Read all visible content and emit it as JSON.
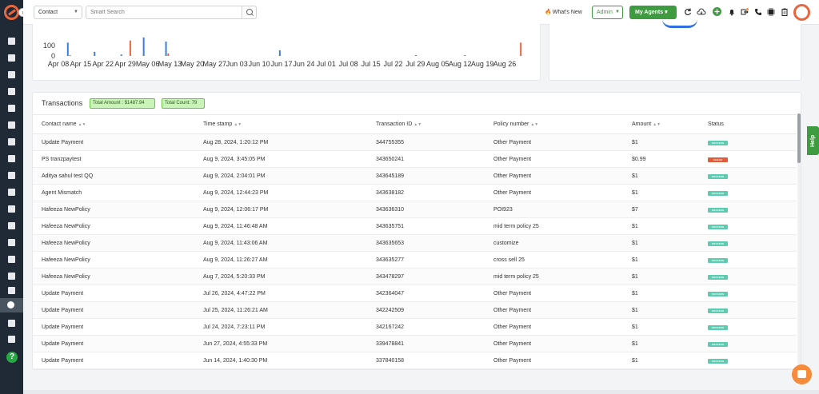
{
  "topbar": {
    "contact_select": "Contact",
    "search_placeholder": "Smart Search",
    "whats_new": "What's New",
    "admin_select": "Admin",
    "my_agents": "My Agents"
  },
  "sidebar": {
    "help_label": "?"
  },
  "chart_data": {
    "type": "bar",
    "y_ticks": [
      "100",
      "0"
    ],
    "x_labels": [
      "Apr 08",
      "Apr 15",
      "Apr 22",
      "Apr 29",
      "May 06",
      "May 13",
      "May 20",
      "May 27",
      "Jun 03",
      "Jun 10",
      "Jun 17",
      "Jun 24",
      "Jul 01",
      "Jul 08",
      "Jul 15",
      "Jul 22",
      "Jul 29",
      "Aug 05",
      "Aug 12",
      "Aug 19",
      "Aug 26"
    ],
    "series": [
      {
        "color": "#3b7ddd",
        "points": [
          [
            0.1,
            130
          ],
          [
            1.3,
            40
          ],
          [
            2.5,
            14
          ],
          [
            3.5,
            180
          ],
          [
            4.5,
            140
          ],
          [
            9.6,
            55
          ],
          [
            15.7,
            8
          ],
          [
            17.9,
            8
          ]
        ]
      },
      {
        "color": "#e8663d",
        "points": [
          [
            0.2,
            8
          ],
          [
            2.9,
            150
          ],
          [
            4.6,
            25
          ],
          [
            20.4,
            130
          ]
        ]
      }
    ],
    "ylim": [
      0,
      210
    ]
  },
  "transactions": {
    "title": "Transactions",
    "total_amount": "Total Amount : $1487.94",
    "total_count": "Total Count: 79",
    "columns": [
      "Contact name",
      "Time stamp",
      "Transaction ID",
      "Policy number",
      "Amount",
      "Status"
    ],
    "rows": [
      {
        "contact": "Update Payment",
        "time": "Aug 28, 2024, 1:20:12 PM",
        "id": "344755355",
        "policy": "Other Payment",
        "amount": "$1",
        "status": "SUCCESS"
      },
      {
        "contact": "PS tranzpaytest",
        "time": "Aug 9, 2024, 3:45:05 PM",
        "id": "343650241",
        "policy": "Other Payment",
        "amount": "$0.99",
        "status": "FAILED"
      },
      {
        "contact": "Aditya sahul test QQ",
        "time": "Aug 9, 2024, 2:04:01 PM",
        "id": "343645189",
        "policy": "Other Payment",
        "amount": "$1",
        "status": "SUCCESS"
      },
      {
        "contact": "Agent Mismatch",
        "time": "Aug 9, 2024, 12:44:23 PM",
        "id": "343638182",
        "policy": "Other Payment",
        "amount": "$1",
        "status": "SUCCESS"
      },
      {
        "contact": "Hafeeza NewPolicy",
        "time": "Aug 9, 2024, 12:06:17 PM",
        "id": "343636310",
        "policy": "POI923",
        "amount": "$7",
        "status": "SUCCESS"
      },
      {
        "contact": "Hafeeza NewPolicy",
        "time": "Aug 9, 2024, 11:46:48 AM",
        "id": "343635751",
        "policy": "mid term policy 25",
        "amount": "$1",
        "status": "SUCCESS"
      },
      {
        "contact": "Hafeeza NewPolicy",
        "time": "Aug 9, 2024, 11:43:06 AM",
        "id": "343635653",
        "policy": "customize",
        "amount": "$1",
        "status": "SUCCESS"
      },
      {
        "contact": "Hafeeza NewPolicy",
        "time": "Aug 9, 2024, 11:26:27 AM",
        "id": "343635277",
        "policy": "cross sell 25",
        "amount": "$1",
        "status": "SUCCESS"
      },
      {
        "contact": "Hafeeza NewPolicy",
        "time": "Aug 7, 2024, 5:20:33 PM",
        "id": "343478297",
        "policy": "mid term policy 25",
        "amount": "$1",
        "status": "SUCCESS"
      },
      {
        "contact": "Update Payment",
        "time": "Jul 26, 2024, 4:47:22 PM",
        "id": "342364047",
        "policy": "Other Payment",
        "amount": "$1",
        "status": "SUCCESS"
      },
      {
        "contact": "Update Payment",
        "time": "Jul 25, 2024, 11:26:21 AM",
        "id": "342242509",
        "policy": "Other Payment",
        "amount": "$1",
        "status": "SUCCESS"
      },
      {
        "contact": "Update Payment",
        "time": "Jul 24, 2024, 7:23:11 PM",
        "id": "342167242",
        "policy": "Other Payment",
        "amount": "$1",
        "status": "SUCCESS"
      },
      {
        "contact": "Update Payment",
        "time": "Jun 27, 2024, 4:55:33 PM",
        "id": "339478841",
        "policy": "Other Payment",
        "amount": "$1",
        "status": "SUCCESS"
      },
      {
        "contact": "Update Payment",
        "time": "Jun 14, 2024, 1:40:30 PM",
        "id": "337840158",
        "policy": "Other Payment",
        "amount": "$1",
        "status": "SUCCESS"
      }
    ]
  },
  "help_tab": "Help",
  "colors": {
    "accent": "#e8663d",
    "green": "#3f9b3f",
    "sidebar": "#1f2a36"
  },
  "icons": [
    "dashboard-icon",
    "contacts-icon",
    "documents-icon",
    "list-icon",
    "reports-icon",
    "filter-icon",
    "campaign-icon",
    "analytics-icon",
    "folder-icon",
    "google-icon",
    "calendar-icon",
    "mail-icon",
    "signature-icon",
    "payments-icon",
    "trend-icon",
    "settings-icon",
    "help-icon"
  ]
}
